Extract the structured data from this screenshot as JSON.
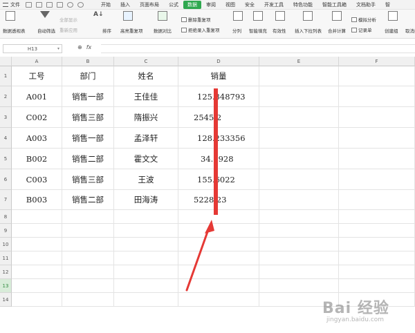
{
  "menubar": {
    "file_label": "文件",
    "tabs": [
      {
        "label": "开始"
      },
      {
        "label": "插入"
      },
      {
        "label": "页面布局"
      },
      {
        "label": "公式"
      },
      {
        "label": "数据",
        "active": true
      },
      {
        "label": "审阅"
      },
      {
        "label": "视图"
      },
      {
        "label": "安全"
      },
      {
        "label": "开发工具"
      },
      {
        "label": "特色功能"
      },
      {
        "label": "智能工具箱"
      },
      {
        "label": "文档助手"
      },
      {
        "label": "智"
      }
    ]
  },
  "ribbon": {
    "pivot": "数据透视表",
    "autofilter": "自动筛选",
    "show_all": "全部显示",
    "reapply": "重新应用",
    "sort": "排序",
    "highlight_dup": "高亮重复项",
    "compare": "数据对比",
    "remove_dup": "删除重复项",
    "reject_dup": "拒绝录入重复项",
    "split": "分列",
    "smart_fill": "智能填充",
    "validity": "有效性",
    "dropdown": "插入下拉列表",
    "consolidate": "合并计算",
    "sim_analysis": "模拟分析",
    "record": "记录单",
    "create_group": "创建组",
    "cancel_group": "取消组"
  },
  "formula_bar": {
    "name_box": "H13",
    "fx_label": "fx",
    "zoom_icon_label": "⊕"
  },
  "sheet": {
    "columns": [
      "A",
      "B",
      "C",
      "D",
      "E",
      "F"
    ],
    "rows": [
      "1",
      "2",
      "3",
      "4",
      "5",
      "6",
      "7",
      "8",
      "9",
      "10",
      "11",
      "12",
      "13",
      "14"
    ],
    "selected_row": "13",
    "header": [
      "工号",
      "部门",
      "姓名",
      "销量"
    ],
    "data": [
      [
        "A001",
        "销售一部",
        "王佳佳",
        "125.348793"
      ],
      [
        "C002",
        "销售三部",
        "隋振兴",
        "2545.2"
      ],
      [
        "A003",
        "销售一部",
        "孟泽轩",
        "128.233356"
      ],
      [
        "B002",
        "销售二部",
        "霍文文",
        "34.7928"
      ],
      [
        "C003",
        "销售三部",
        "王波",
        "155.6022"
      ],
      [
        "B003",
        "销售二部",
        "田海涛",
        "5228.23"
      ]
    ]
  },
  "annotation": {
    "line_color": "#e53935"
  },
  "watermark": {
    "text": "Bai 经验",
    "sub": "jingyan.baidu.com"
  }
}
